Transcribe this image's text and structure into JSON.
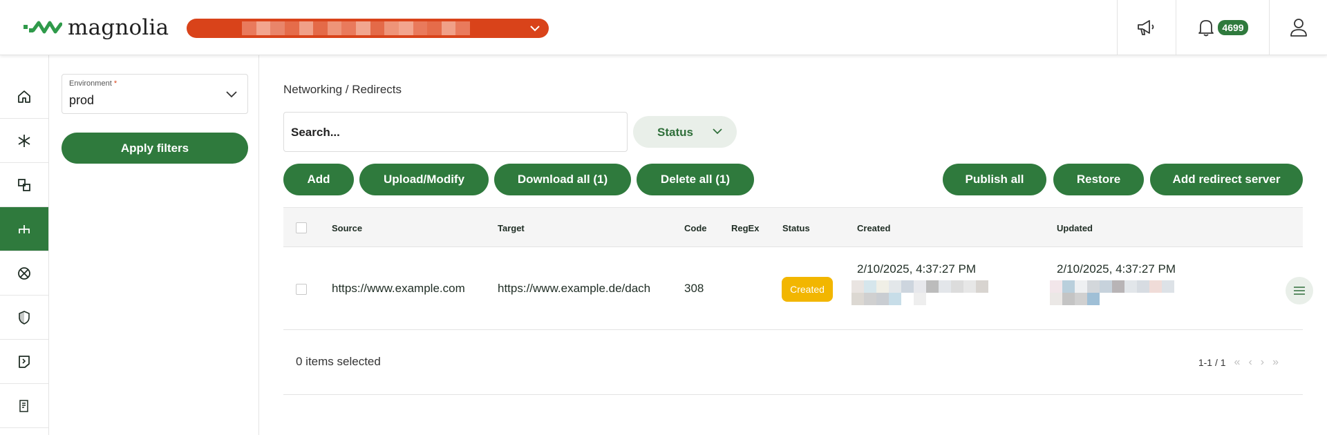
{
  "app": {
    "logo_text": "magnolia"
  },
  "header": {
    "notification_count": "4699",
    "accent_color": "#2f7a3d",
    "project_bar_color": "#d9431a"
  },
  "filters": {
    "environment_label": "Environment",
    "environment_required_mark": "*",
    "environment_value": "prod",
    "apply_label": "Apply filters"
  },
  "main": {
    "breadcrumb": "Networking / Redirects",
    "search_placeholder": "Search...",
    "status_filter_label": "Status",
    "buttons": {
      "add": "Add",
      "upload": "Upload/Modify",
      "download_all": "Download all (1)",
      "delete_all": "Delete all (1)",
      "publish_all": "Publish all",
      "restore": "Restore",
      "add_redirect_server": "Add redirect server"
    },
    "table": {
      "columns": [
        "Source",
        "Target",
        "Code",
        "RegEx",
        "Status",
        "Created",
        "Updated"
      ],
      "rows": [
        {
          "source": "https://www.example.com",
          "target": "https://www.example.de/dach",
          "code": "308",
          "regex": "",
          "status": "Created",
          "created": "2/10/2025, 4:37:27 PM",
          "updated": "2/10/2025, 4:37:27 PM"
        }
      ]
    },
    "footer": {
      "selected_text": "0 items selected",
      "page_range": "1-1 / 1"
    }
  }
}
